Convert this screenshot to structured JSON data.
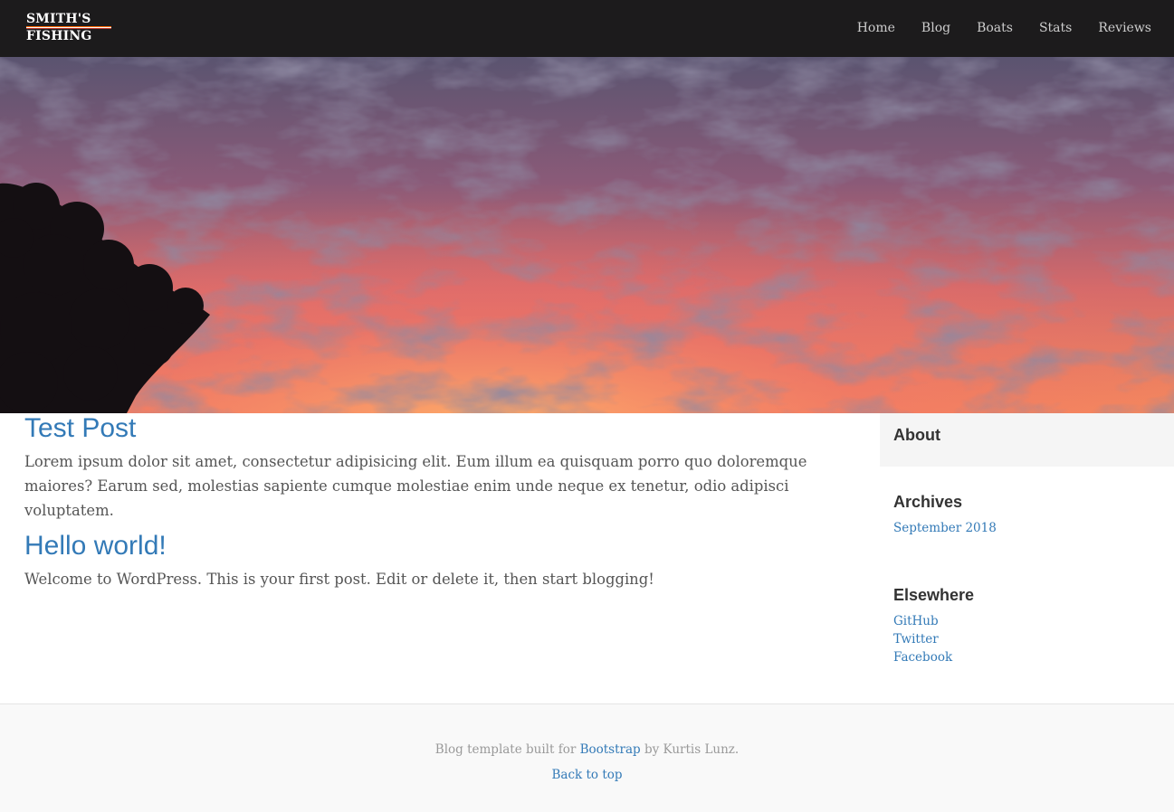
{
  "brand": {
    "line1": "SMITH'S",
    "line2": "FISHING"
  },
  "nav": {
    "items": [
      "Home",
      "Blog",
      "Boats",
      "Stats",
      "Reviews"
    ]
  },
  "posts": [
    {
      "title": "Test Post",
      "body": "Lorem ipsum dolor sit amet, consectetur adipisicing elit. Eum illum ea quisquam porro quo doloremque maiores? Earum sed, molestias sapiente cumque molestiae enim unde neque ex tenetur, odio adipisci voluptatem."
    },
    {
      "title": "Hello world!",
      "body": "Welcome to WordPress. This is your first post. Edit or delete it, then start blogging!"
    }
  ],
  "sidebar": {
    "about_title": "About",
    "archives_title": "Archives",
    "archives": [
      "September 2018"
    ],
    "elsewhere_title": "Elsewhere",
    "elsewhere": [
      "GitHub",
      "Twitter",
      "Facebook"
    ]
  },
  "footer": {
    "text_before": "Blog template built for",
    "link": "Bootstrap",
    "text_after": "by Kurtis Lunz.",
    "back_to_top": "Back to top"
  },
  "colors": {
    "navbar_bg": "#1c1b1c",
    "link": "#337ab7",
    "about_bg": "#f5f5f5",
    "footer_bg": "#f9f9f9"
  },
  "icons": {
    "logo": "smiths-fishing-logo",
    "hero": "sunset-clouds-with-tree-silhouette"
  }
}
